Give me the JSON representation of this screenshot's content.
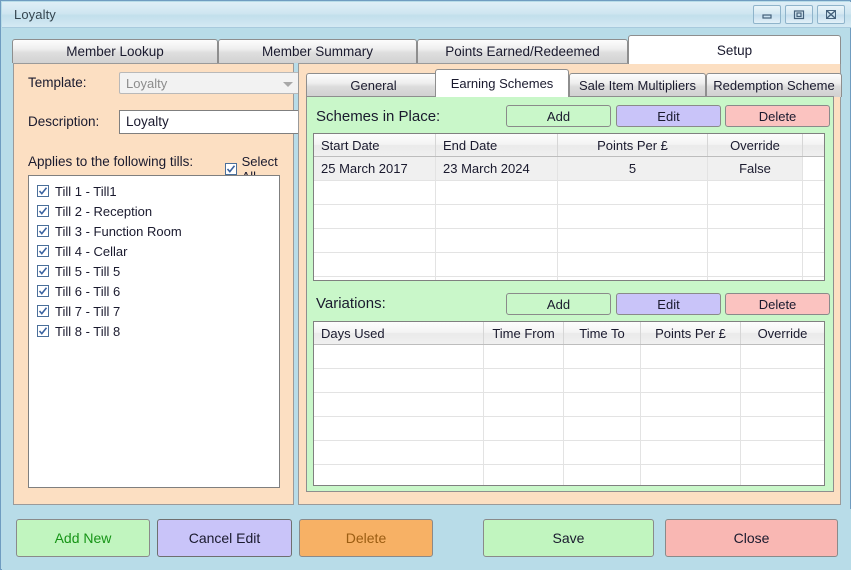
{
  "window": {
    "title": "Loyalty",
    "controls": [
      {
        "name": "minimize-button",
        "icon": "minimize-icon"
      },
      {
        "name": "maximize-button",
        "icon": "maximize-icon"
      },
      {
        "name": "close-button",
        "icon": "close-icon"
      }
    ]
  },
  "tabs": [
    {
      "label": "Member Lookup",
      "active": false
    },
    {
      "label": "Member Summary",
      "active": false
    },
    {
      "label": "Points Earned/Redeemed",
      "active": false
    },
    {
      "label": "Setup",
      "active": true
    }
  ],
  "setup": {
    "template_label": "Template:",
    "template_value": "Loyalty",
    "description_label": "Description:",
    "description_value": "Loyalty",
    "tills_label": "Applies to the following tills:",
    "select_all_label": "Select All",
    "select_all_checked": true,
    "tills": [
      {
        "label": "Till 1 - Till1",
        "checked": true
      },
      {
        "label": "Till 2 - Reception",
        "checked": true
      },
      {
        "label": "Till 3 - Function Room",
        "checked": true
      },
      {
        "label": "Till 4 - Cellar",
        "checked": true
      },
      {
        "label": "Till 5 - Till 5",
        "checked": true
      },
      {
        "label": "Till 6 - Till 6",
        "checked": true
      },
      {
        "label": "Till 7 - Till 7",
        "checked": true
      },
      {
        "label": "Till 8 - Till 8",
        "checked": true
      }
    ]
  },
  "subtabs": [
    {
      "label": "General",
      "active": false
    },
    {
      "label": "Earning Schemes",
      "active": true
    },
    {
      "label": "Sale Item Multipliers",
      "active": false
    },
    {
      "label": "Redemption Scheme",
      "active": false
    }
  ],
  "schemes": {
    "title": "Schemes in Place:",
    "add_label": "Add",
    "edit_label": "Edit",
    "delete_label": "Delete",
    "columns": [
      "Start Date",
      "End Date",
      "Points Per £",
      "Override",
      ""
    ],
    "rows": [
      [
        "25 March 2017",
        "23 March 2024",
        "5",
        "False",
        ""
      ]
    ],
    "empty_row_count": 6
  },
  "variations": {
    "title": "Variations:",
    "add_label": "Add",
    "edit_label": "Edit",
    "delete_label": "Delete",
    "columns": [
      "Days Used",
      "Time From",
      "Time To",
      "Points Per £",
      "Override"
    ],
    "rows": [],
    "empty_row_count": 7
  },
  "footer": {
    "add_new_label": "Add New",
    "cancel_edit_label": "Cancel Edit",
    "delete_label": "Delete",
    "save_label": "Save",
    "close_label": "Close"
  },
  "colors": {
    "window_chrome": "#b8dce8",
    "left_panel": "#fcdfc2",
    "green_panel": "#c9f7c9",
    "add_button": "#c9f7c9",
    "edit_button": "#c9c4f9",
    "delete_button": "#fbc3c0",
    "footer_delete": "#f7b165"
  }
}
